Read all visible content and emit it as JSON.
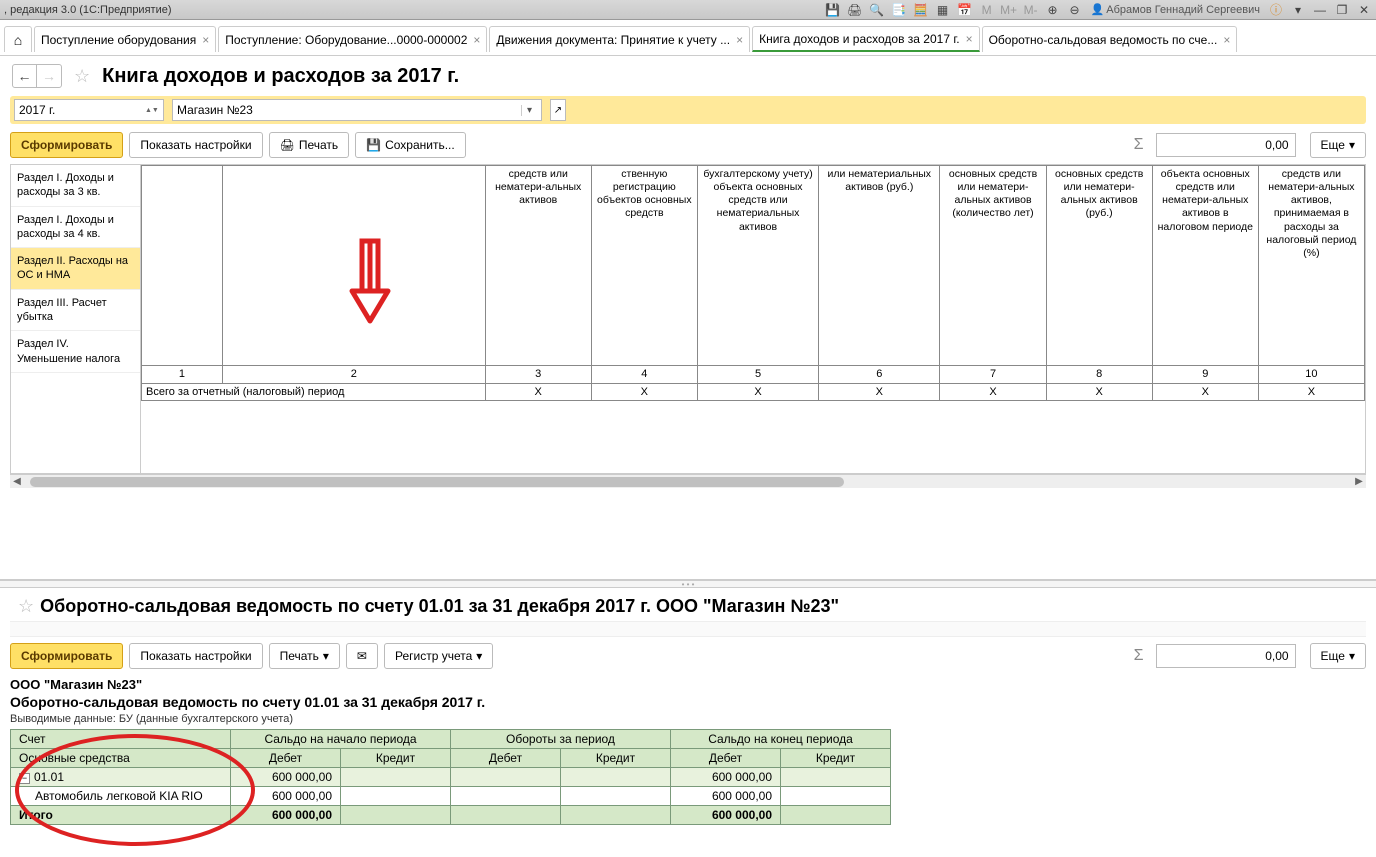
{
  "titlebar": {
    "text": ", редакция 3.0 (1С:Предприятие)",
    "user": "Абрамов Геннадий Сергеевич"
  },
  "tabs": [
    {
      "label": "Поступление оборудования"
    },
    {
      "label": "Поступление: Оборудование...0000-000002"
    },
    {
      "label": "Движения документа: Принятие к учету ..."
    },
    {
      "label": "Книга доходов и расходов за 2017 г.",
      "active": true
    },
    {
      "label": "Оборотно-сальдовая ведомость по сче..."
    }
  ],
  "top": {
    "title": "Книга доходов и расходов за 2017 г.",
    "year": "2017 г.",
    "store": "Магазин №23",
    "btn_form": "Сформировать",
    "btn_settings": "Показать настройки",
    "btn_print": "Печать",
    "btn_save": "Сохранить...",
    "btn_more": "Еще",
    "sum": "0,00",
    "sidebar": [
      "Раздел I. Доходы и расходы за 3 кв.",
      "Раздел I. Доходы и расходы за 4 кв.",
      "Раздел II. Расходы на ОС и НМА",
      "Раздел III. Расчет убытка",
      "Раздел IV. Уменьшение налога"
    ],
    "headers": [
      "",
      "",
      "средств или нематери-альных активов",
      "ственную регистрацию объектов основных средств",
      "бухгалтерскому учету) объекта основных средств или нематериальных активов",
      "или нематериальных активов (руб.)",
      "основных средств или нематери-альных активов (количество лет)",
      "основных средств или нематери-альных активов (руб.)",
      "объекта основных средств или нематери-альных активов в налоговом периоде",
      "средств или нематери-альных активов, принимаемая в расходы за налоговый период (%)"
    ],
    "col_nums": [
      "1",
      "2",
      "3",
      "4",
      "5",
      "6",
      "7",
      "8",
      "9",
      "10"
    ],
    "total_label": "Всего за отчетный  (налоговый) период",
    "total_vals": [
      "",
      "",
      "X",
      "X",
      "X",
      "X",
      "X",
      "X",
      "X",
      "X"
    ]
  },
  "bottom": {
    "title": "Оборотно-сальдовая ведомость по счету 01.01 за 31 декабря 2017 г. ООО \"Магазин №23\"",
    "btn_form": "Сформировать",
    "btn_settings": "Показать настройки",
    "btn_print": "Печать",
    "btn_reg": "Регистр учета",
    "btn_more": "Еще",
    "sum": "0,00",
    "org": "ООО \"Магазин №23\"",
    "rep_title": "Оборотно-сальдовая ведомость по счету 01.01 за 31 декабря 2017 г.",
    "rep_sub": "Выводимые данные:   БУ (данные бухгалтерского учета)",
    "hdr_account": "Счет",
    "hdr_start": "Сальдо на начало периода",
    "hdr_turn": "Обороты за период",
    "hdr_end": "Сальдо на конец периода",
    "hdr_debit": "Дебет",
    "hdr_credit": "Кредит",
    "hdr_os": "Основные средства",
    "rows": {
      "acct": "01.01",
      "acct_val": "600 000,00",
      "item": "Автомобиль легковой KIA RIO",
      "item_val": "600 000,00",
      "total": "Итого",
      "total_val": "600 000,00"
    }
  }
}
